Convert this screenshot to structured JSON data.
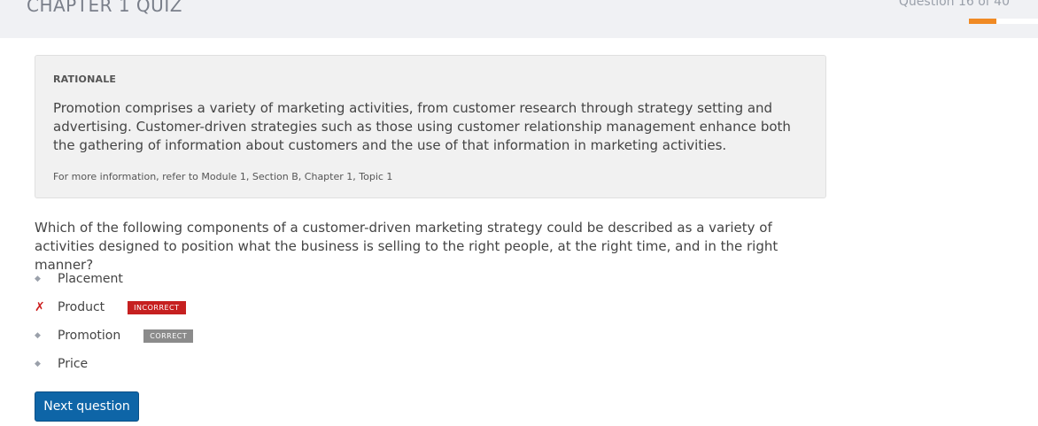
{
  "header": {
    "title": "CHAPTER 1 QUIZ",
    "progress_text": "Question 16 of 40",
    "progress_fraction": 0.4,
    "progress_color": "#f08a24"
  },
  "rationale": {
    "heading": "RATIONALE",
    "body": "Promotion comprises a variety of marketing activities, from customer research through strategy setting and advertising. Customer-driven strategies such as those using customer relationship management enhance both the gathering of information about customers and the use of that information in marketing activities.",
    "reference": "For more information, refer to Module 1, Section B, Chapter 1, Topic 1"
  },
  "question": {
    "text": "Which of the following components of a customer-driven marketing strategy could be described as a variety of activities designed to position what the business is selling to the right people, at the right time, and in the right manner?"
  },
  "options": [
    {
      "label": "Placement",
      "marker": "◆",
      "status": ""
    },
    {
      "label": "Product",
      "marker": "✗",
      "status": "INCORRECT"
    },
    {
      "label": "Promotion",
      "marker": "◆",
      "status": "CORRECT"
    },
    {
      "label": "Price",
      "marker": "◆",
      "status": ""
    }
  ],
  "icons": {
    "option_marker": "diamond-bullet-icon",
    "wrong_marker": "x-mark-icon"
  },
  "colors": {
    "incorrect": "#c62020",
    "correct": "#8b8b8b",
    "primary_button": "#0e65a7"
  },
  "actions": {
    "next_label": "Next question"
  }
}
